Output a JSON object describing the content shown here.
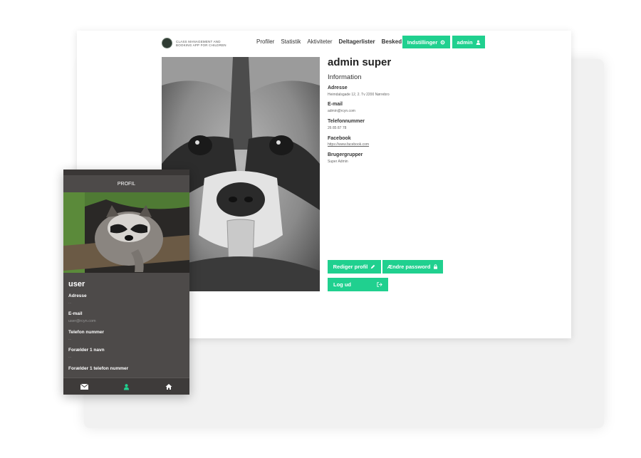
{
  "app": {
    "logo_text": "CLASS MANAGEMENT AND BOOKING APP FOR CHILDREN"
  },
  "nav": {
    "items": [
      "Profiler",
      "Statistik",
      "Aktiviteter",
      "Deltagerlister",
      "Besked"
    ],
    "settings_label": "Indstillinger",
    "user_label": "admin"
  },
  "profile": {
    "name": "admin super",
    "section_title": "Information",
    "fields": [
      {
        "label": "Adresse",
        "value": "Heimdalsgade 12, 2. Tv 2200 Nørrebro"
      },
      {
        "label": "E-mail",
        "value": "admin@rcyn.com"
      },
      {
        "label": "Telefonnummer",
        "value": "26 85 87 78"
      },
      {
        "label": "Facebook",
        "value": "https://www.facebook.com"
      },
      {
        "label": "Brugergrupper",
        "value": "Super Admin"
      }
    ],
    "edit_label": "Rediger profil",
    "password_label": "Ændre password",
    "logout_label": "Log ud"
  },
  "mobile": {
    "header": "PROFIL",
    "name": "user",
    "fields": [
      {
        "label": "Adresse",
        "value": "..."
      },
      {
        "label": "E-mail",
        "value": "user@rcyn.com"
      },
      {
        "label": "Telefon nummer",
        "value": "..."
      },
      {
        "label": "Forælder 1 navn",
        "value": "..."
      },
      {
        "label": "Forælder 1 telefon nummer",
        "value": ""
      }
    ]
  },
  "icons": {
    "settings": "gear-icon",
    "user": "user-icon",
    "edit": "pencil-icon",
    "password": "lock-icon",
    "logout": "sign-out-icon",
    "mail_tab": "mail-icon",
    "profile_tab": "user-icon",
    "home_tab": "home-icon"
  },
  "colors": {
    "accent": "#20d08f",
    "phone_bg": "#4d4a49"
  }
}
